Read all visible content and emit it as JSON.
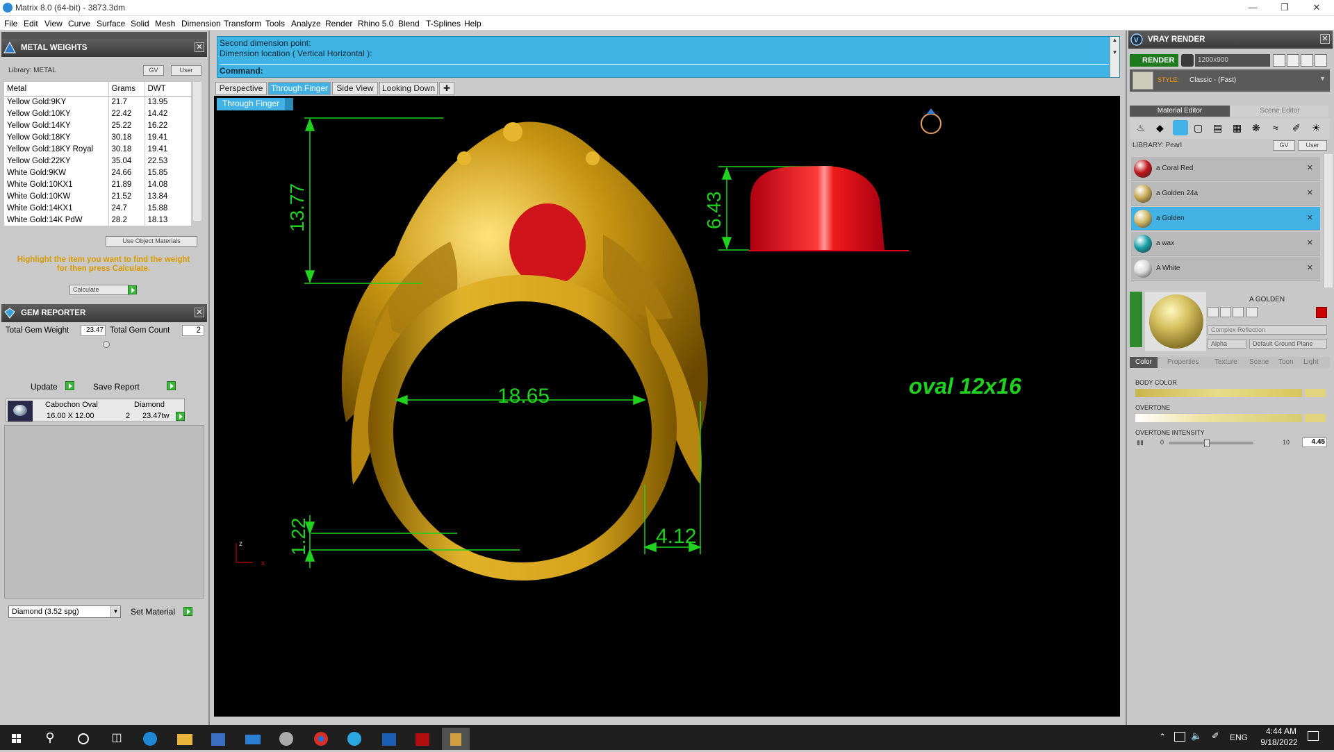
{
  "window": {
    "title": "Matrix 8.0 (64-bit) - 3873.3dm"
  },
  "menu": [
    "File",
    "Edit",
    "View",
    "Curve",
    "Surface",
    "Solid",
    "Mesh",
    "Dimension",
    "Transform",
    "Tools",
    "Analyze",
    "Render",
    "Rhino 5.0",
    "Blend",
    "T-Splines",
    "Help"
  ],
  "metal_weights": {
    "title": "METAL WEIGHTS",
    "library": "Library: METAL",
    "gv": "GV",
    "user": "User",
    "columns": [
      "Metal",
      "Grams",
      "DWT"
    ],
    "rows": [
      [
        "Yellow Gold:9KY",
        "21.7",
        "13.95"
      ],
      [
        "Yellow Gold:10KY",
        "22.42",
        "14.42"
      ],
      [
        "Yellow Gold:14KY",
        "25.22",
        "16.22"
      ],
      [
        "Yellow Gold:18KY",
        "30.18",
        "19.41"
      ],
      [
        "Yellow Gold:18KY Royal",
        "30.18",
        "19.41"
      ],
      [
        "Yellow Gold:22KY",
        "35.04",
        "22.53"
      ],
      [
        "White Gold:9KW",
        "24.66",
        "15.85"
      ],
      [
        "White Gold:10KX1",
        "21.89",
        "14.08"
      ],
      [
        "White Gold:10KW",
        "21.52",
        "13.84"
      ],
      [
        "White Gold:14KX1",
        "24.7",
        "15.88"
      ],
      [
        "White Gold:14K PdW",
        "28.2",
        "18.13"
      ]
    ],
    "use_object_materials": "Use Object Materials",
    "hint": "Highlight the item you want to find the weight for then press Calculate.",
    "calculate": "Calculate"
  },
  "gem_reporter": {
    "title": "GEM REPORTER",
    "total_gem_weight_label": "Total Gem Weight",
    "total_gem_weight": "23.47",
    "total_gem_count_label": "Total Gem Count",
    "total_gem_count": "2",
    "update": "Update",
    "save_report": "Save Report",
    "gem_cut": "Cabochon Oval",
    "gem_material": "Diamond",
    "gem_size": "16.00 X 12.00",
    "gem_count": "2",
    "gem_weight": "23.47tw",
    "material_select": "Diamond    (3.52 spg)",
    "set_material": "Set Material"
  },
  "command": {
    "line1": "Second dimension point:",
    "line2": "Dimension location ( Vertical  Horizontal ):",
    "label": "Command:"
  },
  "view_tabs": [
    "Perspective",
    "Through Finger",
    "Side View",
    "Looking Down"
  ],
  "active_view": "Through Finger",
  "viewport": {
    "dims": {
      "height": "13.77",
      "inner": "18.65",
      "bottom": "1.22",
      "side": "4.12",
      "stone_h": "6.43"
    },
    "stone_label": "oval 12x16",
    "axis_z": "z",
    "axis_x": "x"
  },
  "vray": {
    "title": "VRAY RENDER",
    "render": "RENDER",
    "resolution": "1200x900",
    "style_label": "STYLE:",
    "style_value": "Classic - (Fast)",
    "tab_material": "Material Editor",
    "tab_scene": "Scene Editor",
    "library": "LIBRARY: Pearl",
    "gv": "GV",
    "user": "User",
    "materials": [
      {
        "name": "a Coral Red",
        "color": "#c0161b"
      },
      {
        "name": "a Golden 24a",
        "color": "#c8a955"
      },
      {
        "name": "a Golden",
        "color": "#cdb766"
      },
      {
        "name": "a wax",
        "color": "#1aa0a8"
      },
      {
        "name": "A White",
        "color": "#d8d8d8"
      }
    ],
    "selected_material": "A GOLDEN",
    "reflection": "Complex Reflection",
    "alpha": "Alpha",
    "ground": "Default Ground Plane",
    "subtabs": [
      "Color",
      "Properties",
      "Texture",
      "Scene",
      "Toon",
      "Light"
    ],
    "body_color": "BODY COLOR",
    "overtone": "OVERTONE",
    "overtone_intensity": "OVERTONE INTENSITY",
    "intensity_min": "0",
    "intensity_max": "10",
    "intensity_value": "4.45",
    "intensity_fraction": 0.445,
    "accent": "#41b2e3"
  },
  "taskbar": {
    "lang": "ENG",
    "time": "4:44 AM",
    "date": "9/18/2022"
  }
}
